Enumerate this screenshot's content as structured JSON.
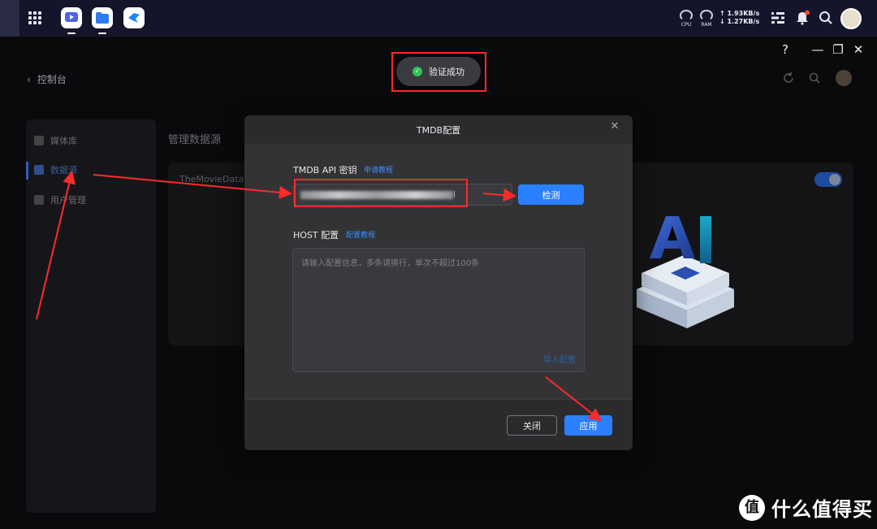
{
  "topbar": {
    "cpu_label": "CPU",
    "ram_label": "RAM",
    "upload_speed": "↑ 1.93KB/s",
    "download_speed": "↓ 1.27KB/s"
  },
  "window": {
    "help": "?",
    "minimize": "—",
    "restore": "❐",
    "close": "✕"
  },
  "header": {
    "breadcrumb": "控制台"
  },
  "sidebar": {
    "items": [
      {
        "label": "媒体库"
      },
      {
        "label": "数据源"
      },
      {
        "label": "用户管理"
      }
    ]
  },
  "main": {
    "title": "管理数据源",
    "card_name": "TheMovieDatab"
  },
  "toast": {
    "text": "验证成功"
  },
  "modal": {
    "title": "TMDB配置",
    "close": "✕",
    "api_label": "TMDB API 密钥",
    "api_link": "申请教程",
    "api_value_tail": "l",
    "detect_button": "检测",
    "host_label": "HOST 配置",
    "host_link": "配置教程",
    "host_placeholder": "请输入配置信息，多条请换行，单次不超过100条",
    "import_link": "导入配置",
    "close_button": "关闭",
    "apply_button": "应用"
  },
  "watermark": {
    "badge": "值",
    "text": "什么值得买"
  },
  "colors": {
    "accent": "#2a80ff",
    "annotation": "#ff2a2a",
    "success": "#2fc25b"
  }
}
